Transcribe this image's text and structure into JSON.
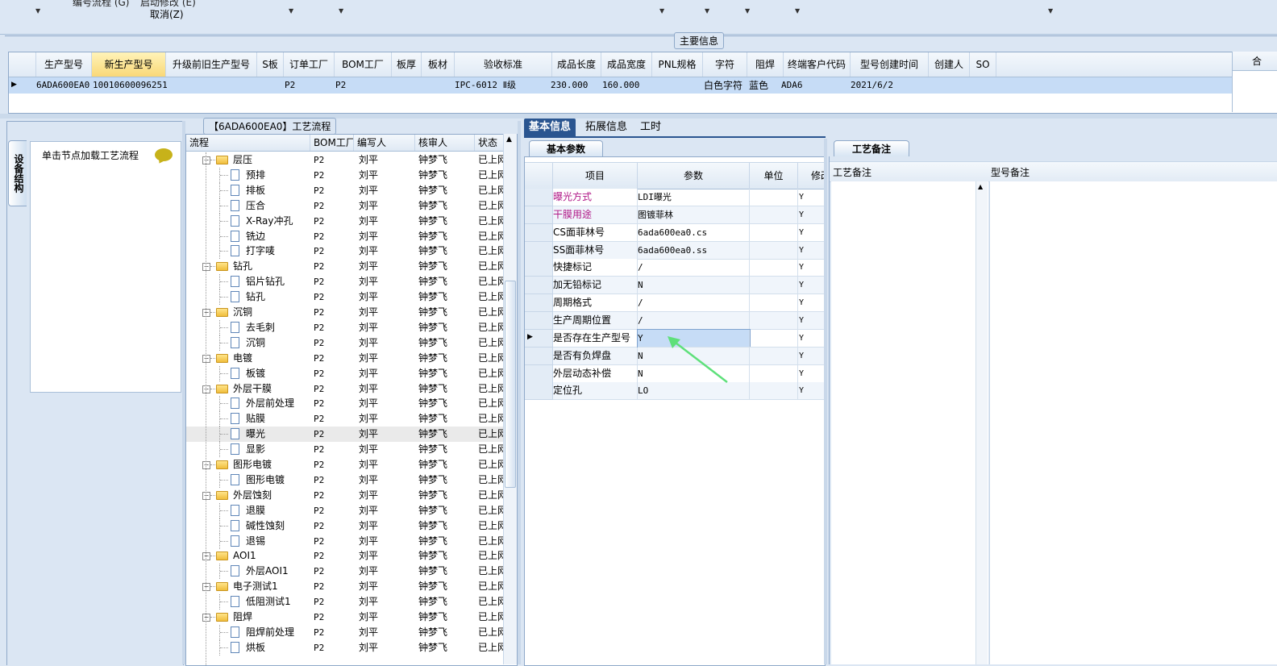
{
  "top": {
    "partial_label_1": "编号流程 (G)",
    "partial_label_2": "启动修改 (E)",
    "cancel_label": "取消(Z)"
  },
  "main_info": {
    "title": "主要信息",
    "columns": [
      "生产型号",
      "新生产型号",
      "升级前旧生产型号",
      "S板",
      "订单工厂",
      "BOM工厂",
      "板厚",
      "板材",
      "验收标准",
      "成品长度",
      "成品宽度",
      "PNL规格",
      "字符",
      "阻焊",
      "终端客户代码",
      "型号创建时间",
      "创建人",
      "SO"
    ],
    "row": [
      "6ADA600EA0",
      "10010600096251",
      "",
      "",
      "P2",
      "P2",
      "",
      "",
      "IPC-6012 Ⅱ级",
      "230.000",
      "160.000",
      "",
      "白色字符",
      "蓝色",
      "ADA6",
      "2021/6/2",
      "",
      ""
    ],
    "right_header_partial": "合"
  },
  "left_panel": {
    "vertical_tab": "设备结构",
    "hint": "单击节点加载工艺流程"
  },
  "process_tree": {
    "title": "【6ADA600EA0】工艺流程",
    "columns": [
      "流程",
      "BOM工厂",
      "编写人",
      "核审人",
      "状态"
    ],
    "rows": [
      {
        "name": "层压",
        "folder": true,
        "bom": "P2",
        "author": "刘平",
        "reviewer": "钟梦飞",
        "status": "已上网"
      },
      {
        "name": "预排",
        "folder": false,
        "bom": "P2",
        "author": "刘平",
        "reviewer": "钟梦飞",
        "status": "已上网"
      },
      {
        "name": "排板",
        "folder": false,
        "bom": "P2",
        "author": "刘平",
        "reviewer": "钟梦飞",
        "status": "已上网"
      },
      {
        "name": "压合",
        "folder": false,
        "bom": "P2",
        "author": "刘平",
        "reviewer": "钟梦飞",
        "status": "已上网"
      },
      {
        "name": "X-Ray冲孔",
        "folder": false,
        "bom": "P2",
        "author": "刘平",
        "reviewer": "钟梦飞",
        "status": "已上网"
      },
      {
        "name": "铣边",
        "folder": false,
        "bom": "P2",
        "author": "刘平",
        "reviewer": "钟梦飞",
        "status": "已上网"
      },
      {
        "name": "打字唛",
        "folder": false,
        "bom": "P2",
        "author": "刘平",
        "reviewer": "钟梦飞",
        "status": "已上网"
      },
      {
        "name": "钻孔",
        "folder": true,
        "bom": "P2",
        "author": "刘平",
        "reviewer": "钟梦飞",
        "status": "已上网"
      },
      {
        "name": "铝片钻孔",
        "folder": false,
        "bom": "P2",
        "author": "刘平",
        "reviewer": "钟梦飞",
        "status": "已上网"
      },
      {
        "name": "钻孔",
        "folder": false,
        "bom": "P2",
        "author": "刘平",
        "reviewer": "钟梦飞",
        "status": "已上网"
      },
      {
        "name": "沉铜",
        "folder": true,
        "bom": "P2",
        "author": "刘平",
        "reviewer": "钟梦飞",
        "status": "已上网"
      },
      {
        "name": "去毛刺",
        "folder": false,
        "bom": "P2",
        "author": "刘平",
        "reviewer": "钟梦飞",
        "status": "已上网"
      },
      {
        "name": "沉铜",
        "folder": false,
        "bom": "P2",
        "author": "刘平",
        "reviewer": "钟梦飞",
        "status": "已上网"
      },
      {
        "name": "电镀",
        "folder": true,
        "bom": "P2",
        "author": "刘平",
        "reviewer": "钟梦飞",
        "status": "已上网"
      },
      {
        "name": "板镀",
        "folder": false,
        "bom": "P2",
        "author": "刘平",
        "reviewer": "钟梦飞",
        "status": "已上网"
      },
      {
        "name": "外层干膜",
        "folder": true,
        "bom": "P2",
        "author": "刘平",
        "reviewer": "钟梦飞",
        "status": "已上网"
      },
      {
        "name": "外层前处理",
        "folder": false,
        "bom": "P2",
        "author": "刘平",
        "reviewer": "钟梦飞",
        "status": "已上网"
      },
      {
        "name": "贴膜",
        "folder": false,
        "bom": "P2",
        "author": "刘平",
        "reviewer": "钟梦飞",
        "status": "已上网"
      },
      {
        "name": "曝光",
        "folder": false,
        "bom": "P2",
        "author": "刘平",
        "reviewer": "钟梦飞",
        "status": "已上网",
        "selected": true
      },
      {
        "name": "显影",
        "folder": false,
        "bom": "P2",
        "author": "刘平",
        "reviewer": "钟梦飞",
        "status": "已上网"
      },
      {
        "name": "图形电镀",
        "folder": true,
        "bom": "P2",
        "author": "刘平",
        "reviewer": "钟梦飞",
        "status": "已上网"
      },
      {
        "name": "图形电镀",
        "folder": false,
        "bom": "P2",
        "author": "刘平",
        "reviewer": "钟梦飞",
        "status": "已上网"
      },
      {
        "name": "外层蚀刻",
        "folder": true,
        "bom": "P2",
        "author": "刘平",
        "reviewer": "钟梦飞",
        "status": "已上网"
      },
      {
        "name": "退膜",
        "folder": false,
        "bom": "P2",
        "author": "刘平",
        "reviewer": "钟梦飞",
        "status": "已上网"
      },
      {
        "name": "碱性蚀刻",
        "folder": false,
        "bom": "P2",
        "author": "刘平",
        "reviewer": "钟梦飞",
        "status": "已上网"
      },
      {
        "name": "退锡",
        "folder": false,
        "bom": "P2",
        "author": "刘平",
        "reviewer": "钟梦飞",
        "status": "已上网"
      },
      {
        "name": "AOI1",
        "folder": true,
        "bom": "P2",
        "author": "刘平",
        "reviewer": "钟梦飞",
        "status": "已上网"
      },
      {
        "name": "外层AOI1",
        "folder": false,
        "bom": "P2",
        "author": "刘平",
        "reviewer": "钟梦飞",
        "status": "已上网"
      },
      {
        "name": "电子测试1",
        "folder": true,
        "bom": "P2",
        "author": "刘平",
        "reviewer": "钟梦飞",
        "status": "已上网"
      },
      {
        "name": "低阻测试1",
        "folder": false,
        "bom": "P2",
        "author": "刘平",
        "reviewer": "钟梦飞",
        "status": "已上网"
      },
      {
        "name": "阻焊",
        "folder": true,
        "bom": "P2",
        "author": "刘平",
        "reviewer": "钟梦飞",
        "status": "已上网"
      },
      {
        "name": "阻焊前处理",
        "folder": false,
        "bom": "P2",
        "author": "刘平",
        "reviewer": "钟梦飞",
        "status": "已上网"
      },
      {
        "name": "烘板",
        "folder": false,
        "bom": "P2",
        "author": "刘平",
        "reviewer": "钟梦飞",
        "status": "已上网"
      }
    ]
  },
  "middle_panel": {
    "tabs": [
      "基本信息",
      "拓展信息",
      "工时"
    ],
    "subtab": "基本参数",
    "columns": [
      "项目",
      "参数",
      "单位",
      "修改"
    ],
    "rows": [
      {
        "item": "曝光方式",
        "value": "LDI曝光",
        "unit": "",
        "mod": "Y",
        "pink": true
      },
      {
        "item": "干膜用途",
        "value": "图镀菲林",
        "unit": "",
        "mod": "Y",
        "pink": true
      },
      {
        "item": "CS面菲林号",
        "value": "6ada600ea0.cs",
        "unit": "",
        "mod": "Y"
      },
      {
        "item": "SS面菲林号",
        "value": "6ada600ea0.ss",
        "unit": "",
        "mod": "Y"
      },
      {
        "item": "快捷标记",
        "value": "/",
        "unit": "",
        "mod": "Y"
      },
      {
        "item": "加无铅标记",
        "value": "N",
        "unit": "",
        "mod": "Y"
      },
      {
        "item": "周期格式",
        "value": "/",
        "unit": "",
        "mod": "Y"
      },
      {
        "item": "生产周期位置",
        "value": "/",
        "unit": "",
        "mod": "Y"
      },
      {
        "item": "是否存在生产型号",
        "value": "Y",
        "unit": "",
        "mod": "Y",
        "selected": true
      },
      {
        "item": "是否有负焊盘",
        "value": "N",
        "unit": "",
        "mod": "Y"
      },
      {
        "item": "外层动态补偿",
        "value": "N",
        "unit": "",
        "mod": "Y"
      },
      {
        "item": "定位孔",
        "value": "LO",
        "unit": "",
        "mod": "Y"
      }
    ]
  },
  "right_panel": {
    "tab": "工艺备注",
    "col1": "工艺备注",
    "col2": "型号备注"
  },
  "colors": {
    "accent": "#2a5590",
    "selection": "#c6dcf6",
    "highlight_text": "#b01887",
    "annotation_arrow": "#5ee07a"
  }
}
